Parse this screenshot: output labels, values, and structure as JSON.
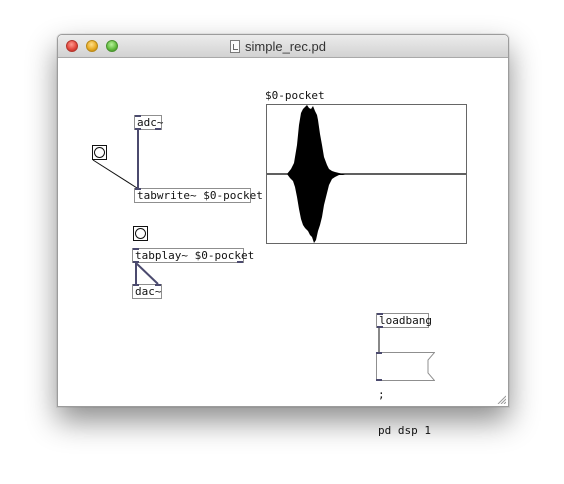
{
  "window": {
    "title": "simple_rec.pd"
  },
  "objects": {
    "adc": "adc~",
    "tabwrite": "tabwrite~ $0-pocket",
    "tabplay": "tabplay~ $0-pocket",
    "dac": "dac~",
    "loadbang": "loadbang"
  },
  "message": {
    "line1": ";",
    "line2": "pd dsp 1"
  },
  "array": {
    "name": "$0-pocket"
  },
  "colors": {
    "cord": "#4b4a6e",
    "waveform": "#000000"
  },
  "icons": [
    "close-icon",
    "minimize-icon",
    "zoom-icon",
    "document-icon",
    "bang-icon",
    "resize-grip-icon"
  ]
}
